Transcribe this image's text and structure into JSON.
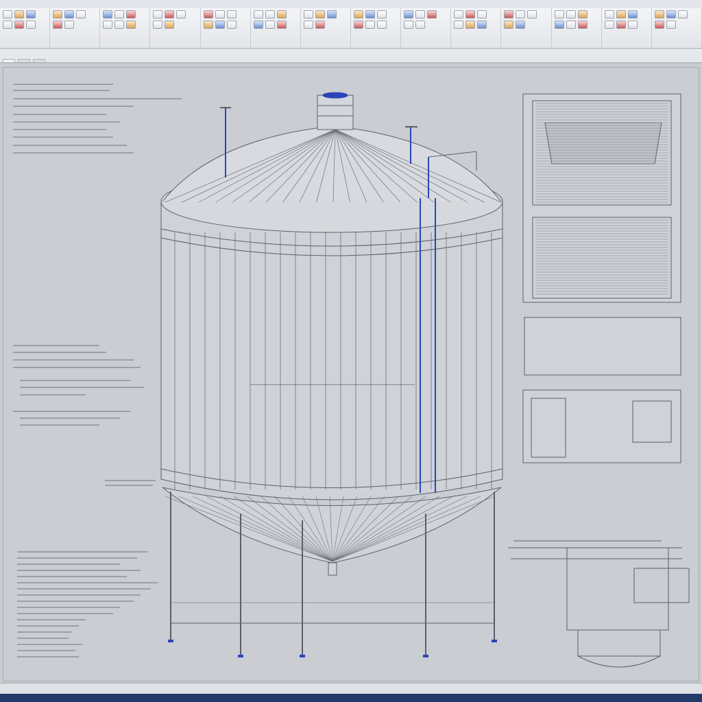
{
  "window": {
    "title": "",
    "status_text": ""
  },
  "ribbon": {
    "groups": [
      {
        "label": "",
        "tools": 6
      },
      {
        "label": "",
        "tools": 5
      },
      {
        "label": "",
        "tools": 6
      },
      {
        "label": "",
        "tools": 5
      },
      {
        "label": "",
        "tools": 6
      },
      {
        "label": "",
        "tools": 6
      },
      {
        "label": "",
        "tools": 5
      },
      {
        "label": "",
        "tools": 6
      },
      {
        "label": "",
        "tools": 5
      },
      {
        "label": "",
        "tools": 6
      },
      {
        "label": "",
        "tools": 5
      },
      {
        "label": "",
        "tools": 6
      },
      {
        "label": "",
        "tools": 6
      },
      {
        "label": "",
        "tools": 5
      }
    ]
  },
  "tabs": [
    {
      "label": ""
    },
    {
      "label": ""
    },
    {
      "label": ""
    }
  ],
  "drawing": {
    "accent_color": "#2b45b8",
    "line_color": "#5a5f68",
    "paper_color": "#cacdd2"
  }
}
